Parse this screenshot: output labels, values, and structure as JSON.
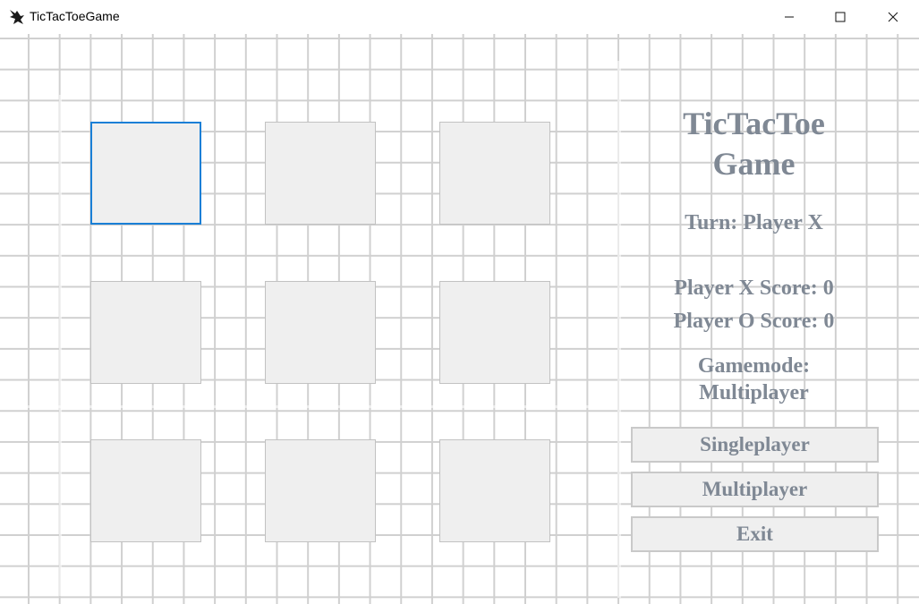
{
  "window": {
    "title": "TicTacToeGame",
    "icon": "app-icon",
    "controls": [
      "minimize-icon",
      "maximize-icon",
      "close-icon"
    ]
  },
  "board": {
    "cells": [
      "",
      "",
      "",
      "",
      "",
      "",
      "",
      "",
      ""
    ],
    "focused_cell": 0
  },
  "panel": {
    "title_line1": "TicTacToe",
    "title_line2": "Game",
    "turn": "Turn: Player X",
    "score_x": "Player X Score: 0",
    "score_o": "Player O Score: 0",
    "gamemode_label": "Gamemode:",
    "gamemode_value": "Multiplayer",
    "buttons": {
      "singleplayer": "Singleplayer",
      "multiplayer": "Multiplayer",
      "exit": "Exit"
    }
  },
  "colors": {
    "text": "#7f8894",
    "focus": "#1a7fd6",
    "cell_bg": "#efefef",
    "grid_line": "#d0d0d0"
  }
}
